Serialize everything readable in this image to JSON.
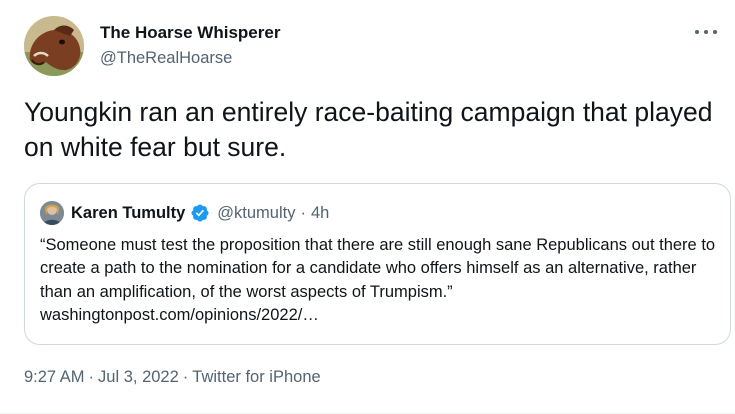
{
  "author": {
    "name": "The Hoarse Whisperer",
    "handle": "@TheRealHoarse",
    "avatar_icon": "horse-avatar-icon"
  },
  "tweet": {
    "text": "Youngkin ran an entirely race-baiting campaign that played on white fear but sure."
  },
  "quoted": {
    "name": "Karen Tumulty",
    "handle": "@ktumulty",
    "separator": "·",
    "time": "4h",
    "verified": true,
    "text": "“Someone must test the proposition that there are still enough sane Republicans out there to create a path to the nomination for a candidate who offers himself as an alternative, rather than an amplification, of the worst aspects of Trumpism.” washingtonpost.com/opinions/2022/…"
  },
  "meta": {
    "time": "9:27 AM",
    "dot1": "·",
    "date": "Jul 3, 2022",
    "dot2": "·",
    "source": "Twitter for iPhone"
  },
  "colors": {
    "text": "#0f1419",
    "secondary": "#536471",
    "border": "#cfd9de",
    "verified": "#1d9bf0"
  }
}
